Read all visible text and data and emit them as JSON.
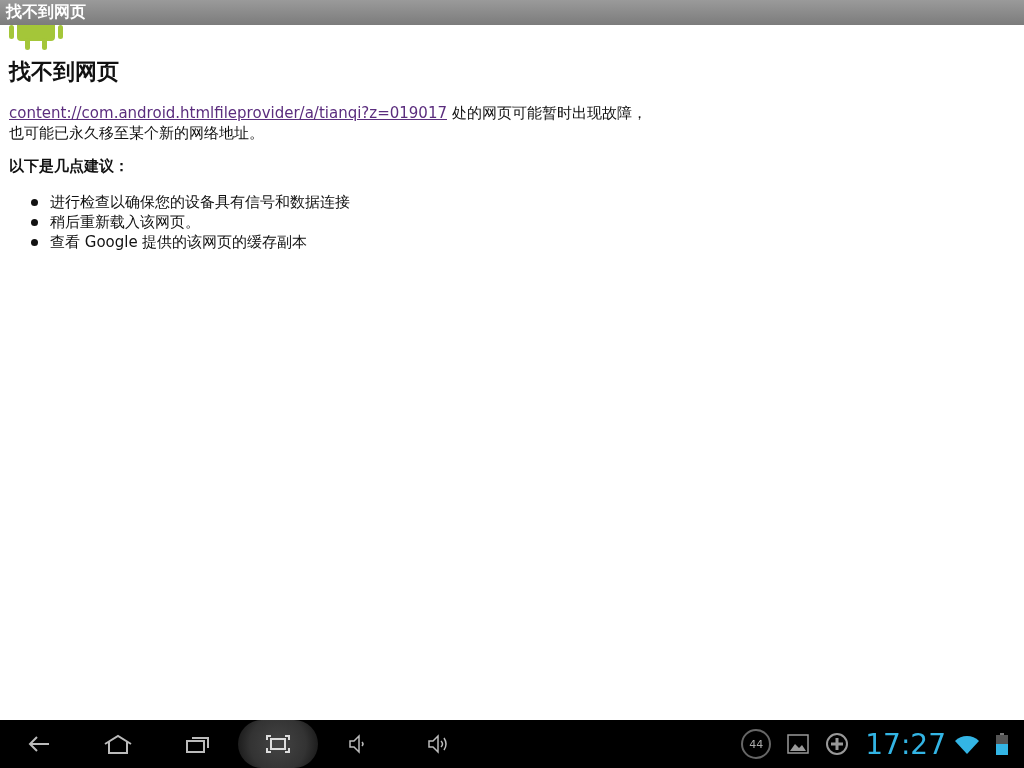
{
  "window": {
    "title": "找不到网页"
  },
  "page": {
    "heading": "找不到网页",
    "link": "content://com.android.htmlfileprovider/a/tianqi?z=019017",
    "message_after_link": " 处的网页可能暂时出现故障，",
    "message_line_2": "也可能已永久移至某个新的网络地址。",
    "suggestions_heading": "以下是几点建议：",
    "suggestions": [
      "进行检查以确保您的设备具有信号和数据连接",
      "稍后重新载入该网页。",
      "查看 Google 提供的该网页的缓存副本"
    ]
  },
  "nav_buttons": [
    {
      "kind": "back",
      "pressed": false
    },
    {
      "kind": "home",
      "pressed": false
    },
    {
      "kind": "recent",
      "pressed": false
    },
    {
      "kind": "screenshot",
      "pressed": true
    },
    {
      "kind": "volume-down",
      "pressed": false
    },
    {
      "kind": "volume-up",
      "pressed": false
    }
  ],
  "status": {
    "counter": "44",
    "time": "17:27"
  }
}
